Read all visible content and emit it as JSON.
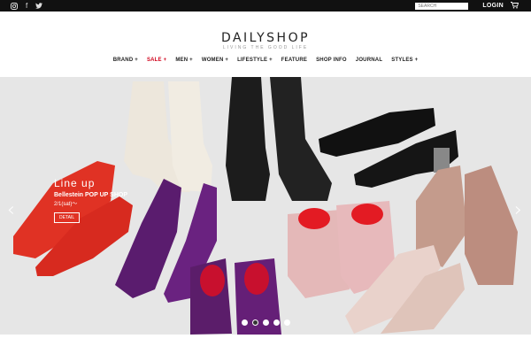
{
  "topbar": {
    "social": [
      {
        "icon": "instagram-icon",
        "glyph": "◘"
      },
      {
        "icon": "facebook-icon",
        "glyph": "f"
      },
      {
        "icon": "twitter-icon",
        "glyph": "🐦"
      }
    ],
    "search_placeholder": "SEARCH",
    "login_label": "LOGIN",
    "cart_icon": "cart-icon"
  },
  "header": {
    "logo_name": "DAILYSHOP",
    "logo_tagline": "LIVING THE GOOD LIFE"
  },
  "nav": {
    "items": [
      {
        "label": "BRAND +"
      },
      {
        "label": "SALE +",
        "color": "#d0021b"
      },
      {
        "label": "MEN +"
      },
      {
        "label": "WOMEN +"
      },
      {
        "label": "LIFESTYLE +"
      },
      {
        "label": "FEATURE"
      },
      {
        "label": "SHOP INFO"
      },
      {
        "label": "JOURNAL"
      },
      {
        "label": "STYLES +"
      }
    ]
  },
  "hero": {
    "caption_title": "Line up",
    "caption_sub": "Bellestein POP UP SHOP",
    "caption_sub2": "2/1(sat)〜",
    "caption_button": "DETAIL",
    "prev_icon": "chevron-left-icon",
    "next_icon": "chevron-right-icon",
    "slides_count": 5,
    "active_slide": 2
  }
}
